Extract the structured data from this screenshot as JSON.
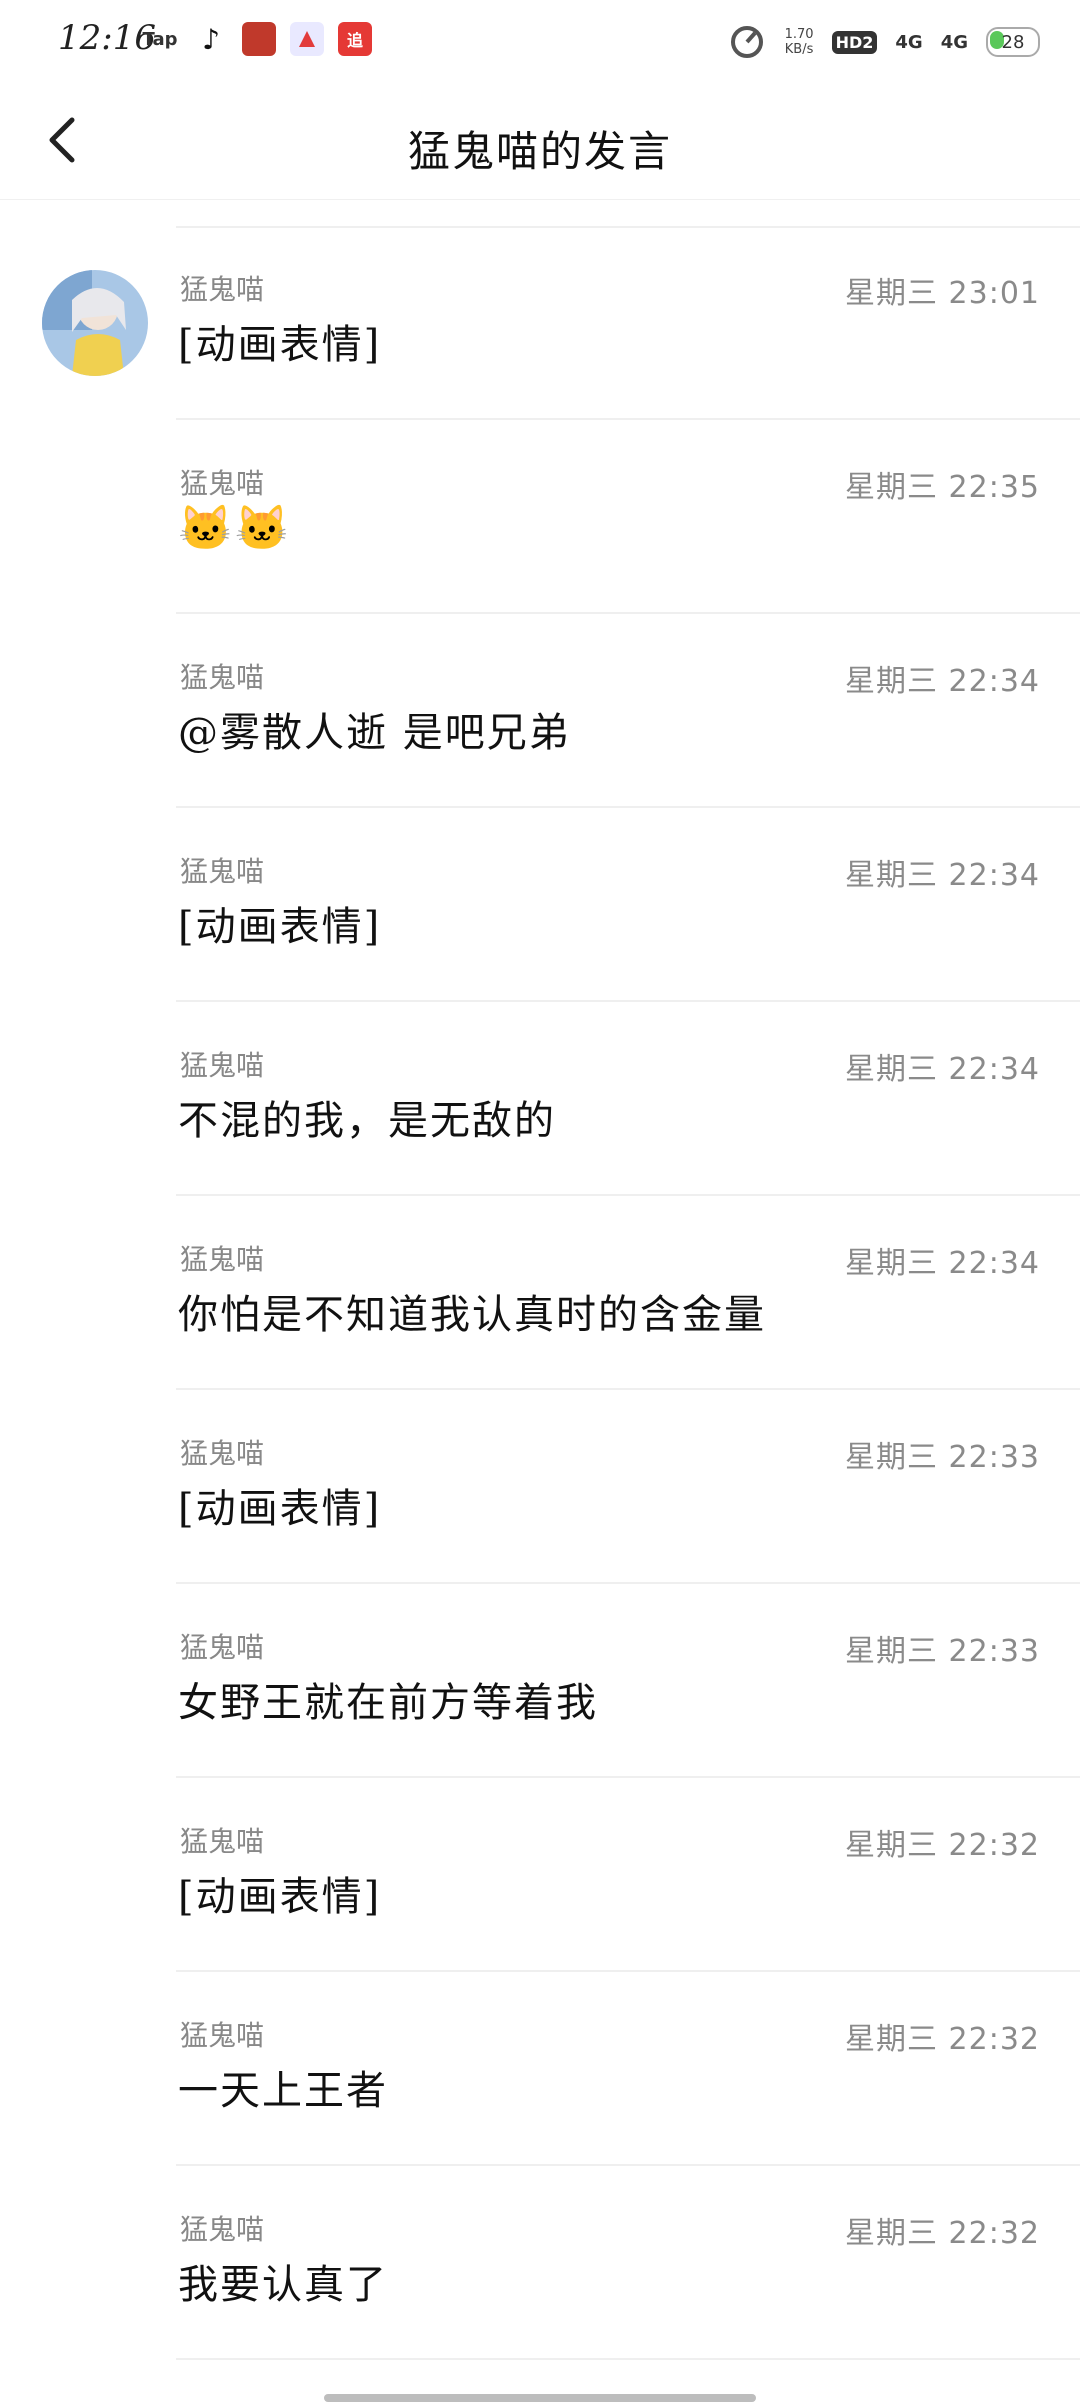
{
  "status_bar": {
    "time": "12:16",
    "apps": [
      "Tap",
      "♪",
      "",
      "",
      "追"
    ],
    "speed_value": "1.70",
    "speed_unit": "KB/s",
    "hd": "HD2",
    "net1": "4G",
    "net2": "4G",
    "battery": "28"
  },
  "header": {
    "title": "猛鬼喵的发言",
    "back_icon": "back-arrow-icon"
  },
  "messages": [
    {
      "name": "猛鬼喵",
      "time": "星期三 23:01",
      "text": "[动画表情]",
      "avatar": true
    },
    {
      "name": "猛鬼喵",
      "time": "星期三 22:35",
      "text": "🐱🐱",
      "emoji": true
    },
    {
      "name": "猛鬼喵",
      "time": "星期三 22:34",
      "text": "@雾散人逝 是吧兄弟"
    },
    {
      "name": "猛鬼喵",
      "time": "星期三 22:34",
      "text": "[动画表情]"
    },
    {
      "name": "猛鬼喵",
      "time": "星期三 22:34",
      "text": "不混的我，是无敌的"
    },
    {
      "name": "猛鬼喵",
      "time": "星期三 22:34",
      "text": "你怕是不知道我认真时的含金量"
    },
    {
      "name": "猛鬼喵",
      "time": "星期三 22:33",
      "text": "[动画表情]"
    },
    {
      "name": "猛鬼喵",
      "time": "星期三 22:33",
      "text": "女野王就在前方等着我"
    },
    {
      "name": "猛鬼喵",
      "time": "星期三 22:32",
      "text": "[动画表情]"
    },
    {
      "name": "猛鬼喵",
      "time": "星期三 22:32",
      "text": "一天上王者"
    },
    {
      "name": "猛鬼喵",
      "time": "星期三 22:32",
      "text": "我要认真了"
    }
  ]
}
